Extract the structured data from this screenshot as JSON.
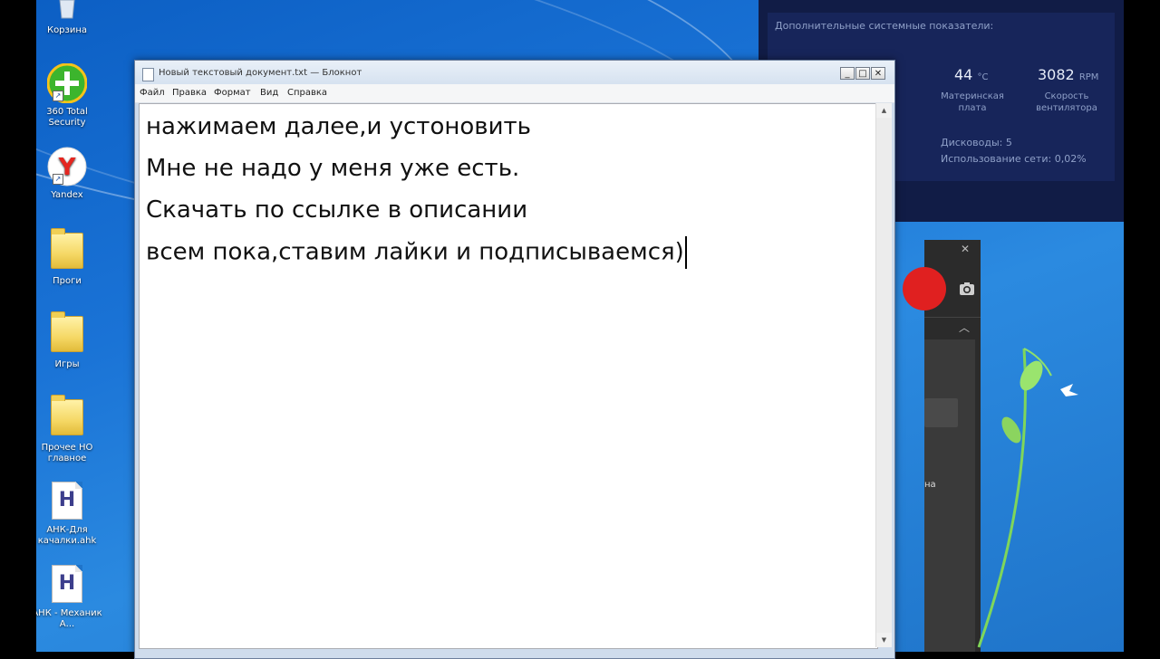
{
  "desktop": {
    "icons": [
      {
        "label": "Корзина",
        "type": "recycle"
      },
      {
        "label": "360 Total Security",
        "type": "app360"
      },
      {
        "label": "Yandex",
        "type": "yandex"
      },
      {
        "label": "Проги",
        "type": "folder"
      },
      {
        "label": "Игры",
        "type": "folder"
      },
      {
        "label": "Прочее НО главное",
        "type": "folder"
      },
      {
        "label": "АНК-Для качалки.ahk",
        "type": "ahk"
      },
      {
        "label": "АНК - Механик А...",
        "type": "ahk"
      }
    ]
  },
  "gadget": {
    "header": "Дополнительные системные показатели:",
    "temp_value": "44",
    "temp_unit": "°C",
    "temp_label": "Материнская плата",
    "fan_value": "3082",
    "fan_unit": "RPM",
    "fan_label": "Скорость вентилятора",
    "drives": "Дисководы: 5",
    "network": "Использование сети: 0,02%"
  },
  "recorder": {
    "close_glyph": "✕",
    "chevron_glyph": "︿",
    "partial_text": "на"
  },
  "notepad": {
    "title": "Новый текстовый документ.txt — Блокнот",
    "menu": {
      "file": "Файл",
      "edit": "Правка",
      "format": "Формат",
      "view": "Вид",
      "help": "Справка"
    },
    "buttons": {
      "minimize": "_",
      "maximize": "□",
      "close": "✕"
    },
    "lines": [
      "нажимаем далее,и устоновить",
      "Мне не надо у меня уже есть.",
      "Скачать по ссылке в описании",
      "всем пока,ставим лайки и подписываемся)"
    ]
  },
  "colors": {
    "desktop_blue": "#1a73d6",
    "gadget_bg": "#111c46",
    "record_red": "#e02020"
  }
}
